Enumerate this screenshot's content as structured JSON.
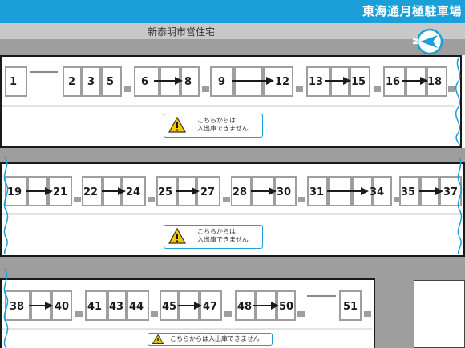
{
  "header": {
    "title": "東海通月極駐車場"
  },
  "landmark": {
    "label": "新泰明市営住宅"
  },
  "compass": {
    "letter": "N",
    "icon": "north-arrow-icon"
  },
  "rows": [
    {
      "spaces": [
        "1",
        "2",
        "3",
        "5",
        "6",
        "8",
        "9",
        "12",
        "13",
        "15",
        "16",
        "18"
      ],
      "notice": {
        "line1": "こちらからは",
        "line2": "入出庫できません"
      }
    },
    {
      "spaces": [
        "19",
        "21",
        "22",
        "24",
        "25",
        "27",
        "28",
        "30",
        "31",
        "34",
        "35",
        "37"
      ],
      "notice": {
        "line1": "こちらからは",
        "line2": "入出庫できません"
      }
    },
    {
      "spaces": [
        "38",
        "40",
        "41",
        "43",
        "44",
        "45",
        "47",
        "48",
        "50",
        "51"
      ],
      "notice": {
        "line1": "こちらからは入出庫できません"
      }
    }
  ],
  "colors": {
    "accent": "#1a9fd8",
    "road": "#9e9e9e",
    "warning": "#f7c600",
    "box_border": "#9e9e9e"
  }
}
